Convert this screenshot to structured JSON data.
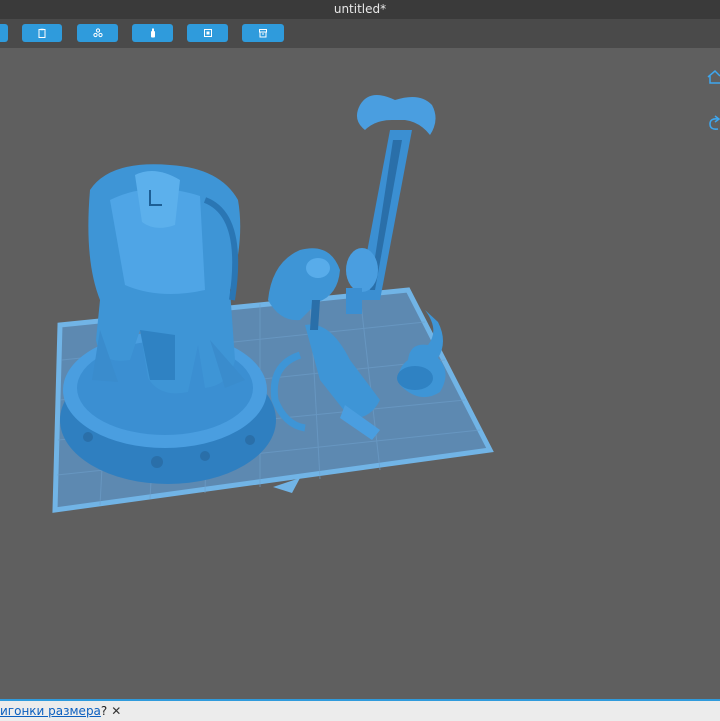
{
  "window": {
    "title": "untitled*"
  },
  "toolbar": {
    "buttons": [
      {
        "name": "tool-button-1",
        "icon": "partial-icon"
      },
      {
        "name": "tool-button-2",
        "icon": "clipboard-icon"
      },
      {
        "name": "tool-button-3",
        "icon": "components-icon"
      },
      {
        "name": "tool-button-4",
        "icon": "bottle-icon"
      },
      {
        "name": "tool-button-5",
        "icon": "square-icon"
      },
      {
        "name": "tool-button-6",
        "icon": "archive-icon"
      }
    ]
  },
  "viewport": {
    "nav": [
      {
        "icon": "home-icon"
      },
      {
        "icon": "rotate-icon"
      }
    ]
  },
  "status": {
    "link_text": "игонки размера",
    "suffix": "?",
    "close_symbol": "✕"
  },
  "colors": {
    "accent": "#2f9bdc",
    "model": "#3e95d6",
    "viewport_bg": "#5f5f5f",
    "plate": "#63a9dd"
  }
}
